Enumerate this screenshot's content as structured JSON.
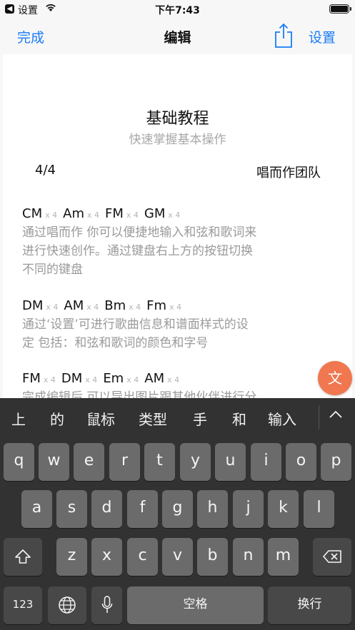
{
  "status_bar": {
    "carrier": "设置",
    "time": "下午7:43"
  },
  "nav": {
    "done": "完成",
    "title": "编辑",
    "settings": "设置",
    "share_icon": "share-icon"
  },
  "doc": {
    "title": "基础教程",
    "subtitle": "快速掌握基本操作",
    "page": "4/4",
    "author": "唱而作团队",
    "sections": [
      {
        "chords": [
          "CM",
          "Am",
          "FM",
          "GM"
        ],
        "multiplier": "x 4",
        "lyrics": [
          "通过唱而作 你可以便捷地输入和弦和歌词来",
          "进行快速创作。通过键盘右上方的按钮切换",
          "不同的键盘"
        ]
      },
      {
        "chords": [
          "DM",
          "AM",
          "Bm",
          "Fm"
        ],
        "multiplier": "x 4",
        "lyrics": [
          "通过‘设置’可进行歌曲信息和谱面样式的设",
          "定 包括：和弦和歌词的颜色和字号"
        ]
      },
      {
        "chords": [
          "FM",
          "DM",
          "Em",
          "AM"
        ],
        "multiplier": "x 4",
        "lyrics": [
          "完成编辑后 可以导出图片跟其他伙伴进行分"
        ]
      }
    ]
  },
  "fab": {
    "label": "文"
  },
  "keyboard": {
    "candidates": [
      "上",
      "的",
      "鼠标",
      "类型",
      "手",
      "和",
      "输入"
    ],
    "row1": [
      "q",
      "w",
      "e",
      "r",
      "t",
      "y",
      "u",
      "i",
      "o",
      "p"
    ],
    "row2": [
      "a",
      "s",
      "d",
      "f",
      "g",
      "h",
      "j",
      "k",
      "l"
    ],
    "row3": [
      "z",
      "x",
      "c",
      "v",
      "b",
      "n",
      "m"
    ],
    "numbers_label": "123",
    "space_label": "空格",
    "return_label": "换行"
  }
}
